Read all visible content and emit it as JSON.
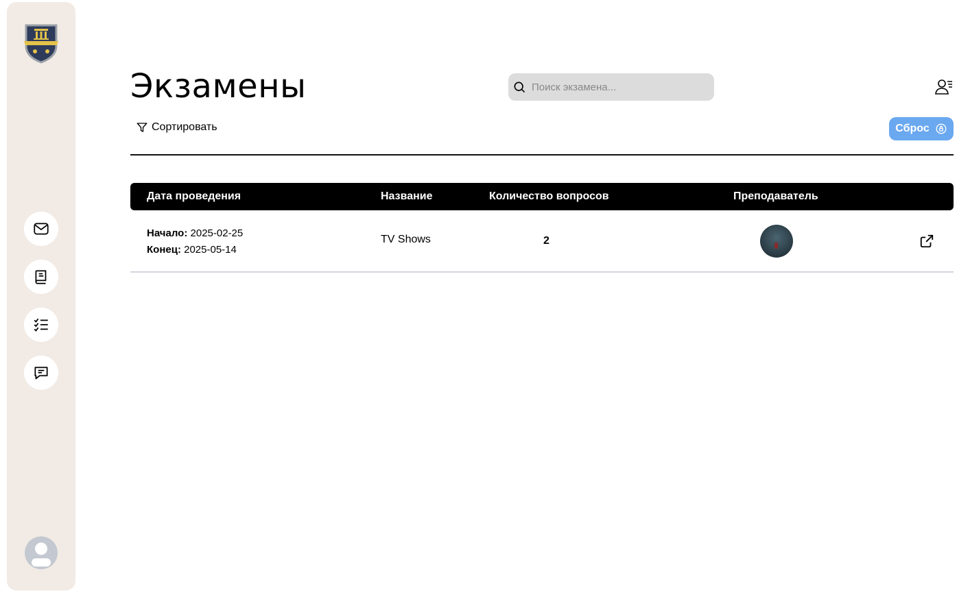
{
  "page": {
    "title": "Экзамены"
  },
  "search": {
    "placeholder": "Поиск экзамена..."
  },
  "toolbar": {
    "sort_label": "Сортировать",
    "reset_label": "Сброс"
  },
  "sidebar": {
    "items": [
      {
        "name": "mail",
        "icon": "mail-icon"
      },
      {
        "name": "book",
        "icon": "book-icon"
      },
      {
        "name": "checklist",
        "icon": "checklist-icon"
      },
      {
        "name": "chat",
        "icon": "chat-icon"
      }
    ]
  },
  "table": {
    "headers": [
      "Дата проведения",
      "Название",
      "Количество вопросов",
      "Преподаватель"
    ],
    "rows": [
      {
        "start_label": "Начало:",
        "start_date": "2025-02-25",
        "end_label": "Конец:",
        "end_date": "2025-05-14",
        "name": "TV Shows",
        "questions": "2"
      }
    ]
  },
  "colors": {
    "sidebar": "#f2ebe5",
    "accent": "#6aa8f0",
    "header": "#000000"
  }
}
